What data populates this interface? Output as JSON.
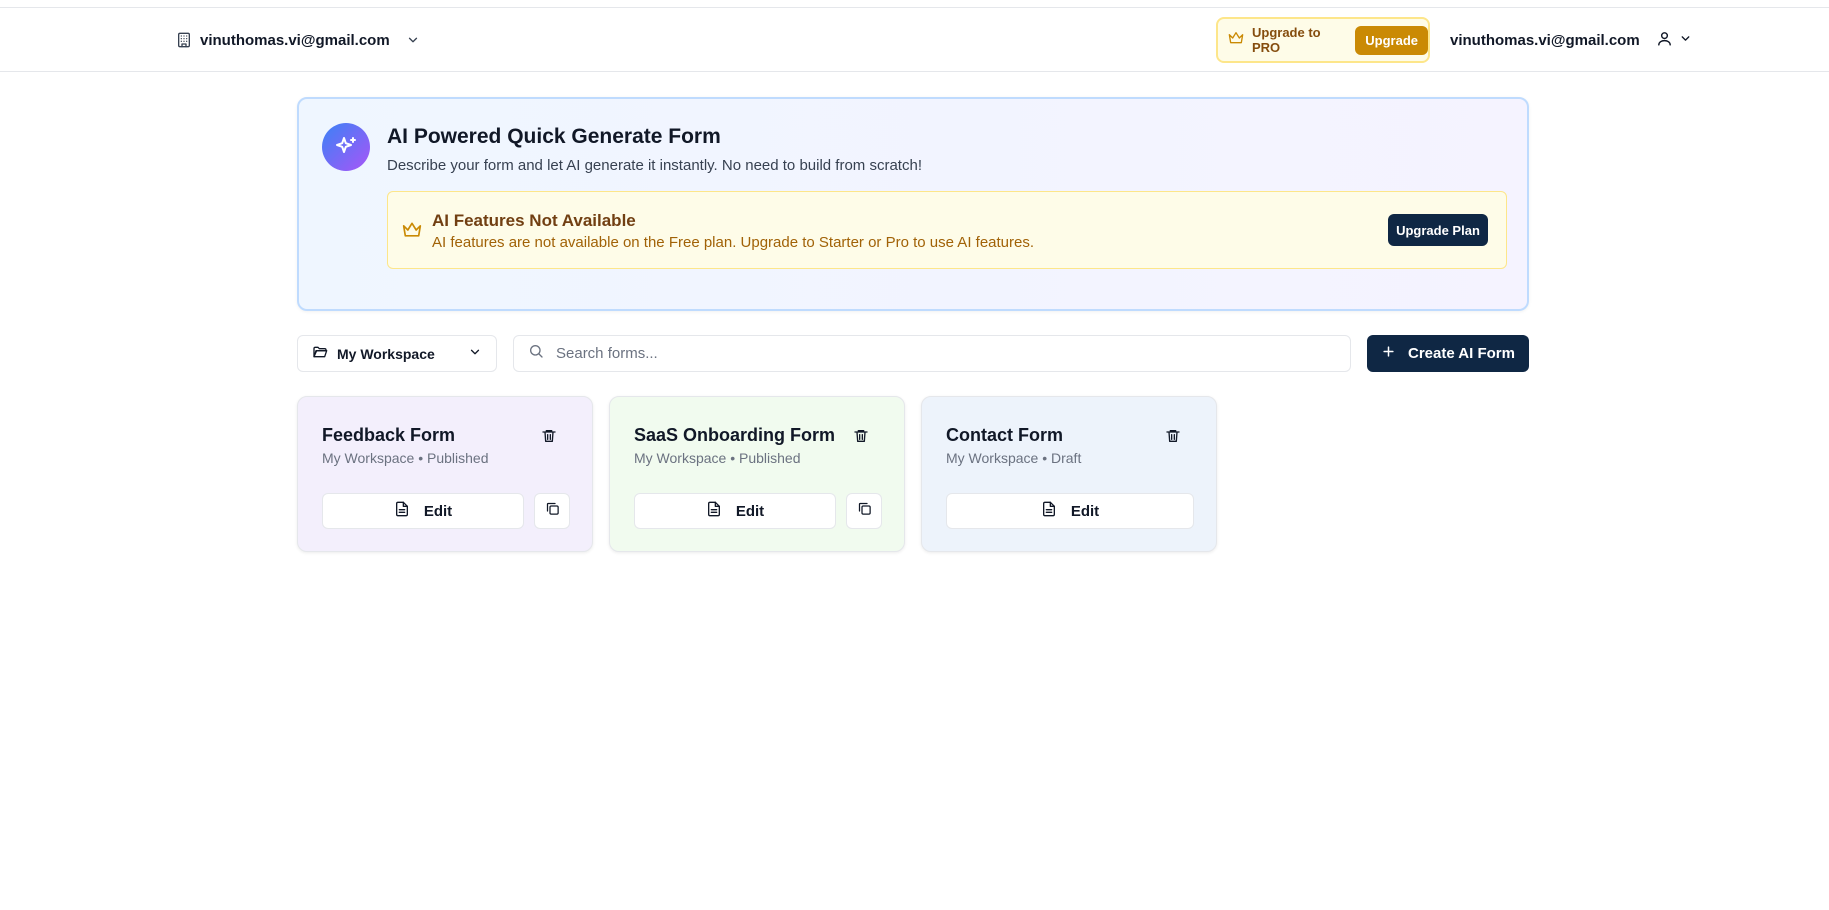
{
  "header": {
    "org_email": "vinuthomas.vi@gmail.com",
    "upgrade_pill_label": "Upgrade to PRO",
    "upgrade_button": "Upgrade",
    "user_email": "vinuthomas.vi@gmail.com",
    "icons": {
      "org": "building-icon",
      "org_chevron": "chevron-down-icon",
      "pro": "crown-icon",
      "user": "user-icon",
      "user_chevron": "chevron-down-icon"
    }
  },
  "ai_panel": {
    "title": "AI Powered Quick Generate Form",
    "subtitle": "Describe your form and let AI generate it instantly. No need to build from scratch!",
    "icon": "sparkles-icon",
    "warning": {
      "title": "AI Features Not Available",
      "text": "AI features are not available on the Free plan. Upgrade to Starter or Pro to use AI features.",
      "button": "Upgrade Plan",
      "icon": "crown-icon"
    }
  },
  "toolbar": {
    "workspace": "My Workspace",
    "search_placeholder": "Search forms...",
    "search_value": "",
    "create_button": "Create AI Form"
  },
  "forms": [
    {
      "title": "Feedback Form",
      "meta": "My Workspace • Published",
      "edit_label": "Edit",
      "has_duplicate": true,
      "bg": "#f3effc"
    },
    {
      "title": "SaaS Onboarding Form",
      "meta": "My Workspace • Published",
      "edit_label": "Edit",
      "has_duplicate": true,
      "bg": "#f1fbef"
    },
    {
      "title": "Contact Form",
      "meta": "My Workspace • Draft",
      "edit_label": "Edit",
      "has_duplicate": false,
      "bg": "#edf3fb"
    }
  ],
  "colors": {
    "primary": "#0f2744",
    "gold": "#ca8a04",
    "warning_bg": "#fefce8"
  }
}
